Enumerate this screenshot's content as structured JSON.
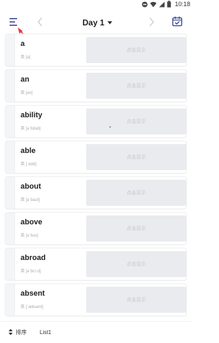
{
  "status_bar": {
    "time": "10:18",
    "icons": [
      "do-not-disturb-icon",
      "wifi-icon",
      "cellular-signal-icon",
      "battery-icon"
    ]
  },
  "header": {
    "menu_icon": "hamburger-menu-icon",
    "prev_icon": "chevron-left-icon",
    "day_label": "Day 1",
    "dropdown_icon": "caret-down-icon",
    "next_icon": "chevron-right-icon",
    "calendar_icon": "calendar-check-icon"
  },
  "colors": {
    "annotation_arrow": "#e53935",
    "accent": "#2d3a8c",
    "reveal_bg": "#e9ebee"
  },
  "words": [
    {
      "word": "a",
      "phonetic": "英 [ə]",
      "reveal_label": "点击显示"
    },
    {
      "word": "an",
      "phonetic": "英 [ən]",
      "reveal_label": "点击显示"
    },
    {
      "word": "ability",
      "phonetic": "英 [əˈbɪləti]",
      "reveal_label": "点击显示"
    },
    {
      "word": "able",
      "phonetic": "英 [ˈeɪbl]",
      "reveal_label": "点击显示"
    },
    {
      "word": "about",
      "phonetic": "英 [əˈbaʊt]",
      "reveal_label": "点击显示"
    },
    {
      "word": "above",
      "phonetic": "英 [əˈbʌv]",
      "reveal_label": "点击显示"
    },
    {
      "word": "abroad",
      "phonetic": "英 [əˈbrɔːd]",
      "reveal_label": "点击显示"
    },
    {
      "word": "absent",
      "phonetic": "英 [ˈæbsənt]",
      "reveal_label": "点击显示"
    }
  ],
  "footer": {
    "sort_icon": "sort-updown-icon",
    "sort_label": "排序",
    "list_label": "List1"
  }
}
